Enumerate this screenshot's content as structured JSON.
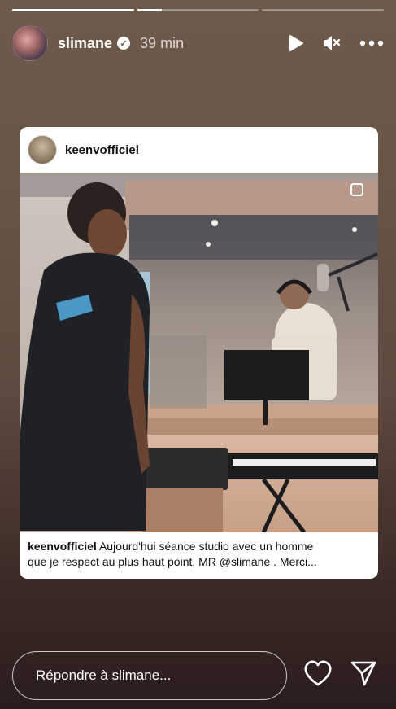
{
  "story": {
    "progress": [
      1.0,
      0.2,
      0.0
    ]
  },
  "header": {
    "username": "slimane",
    "verified": true,
    "time": "39 min",
    "icons": [
      "play-icon",
      "mute-icon",
      "more-icon"
    ]
  },
  "post": {
    "username": "keenvofficiel",
    "caption_user": "keenvofficiel",
    "caption_line1": "Aujourd'hui séance studio avec un homme",
    "caption_line2": "que je respect au plus haut point, MR @slimane . Merci..."
  },
  "footer": {
    "reply_placeholder": "Répondre à slimane...",
    "icons": [
      "heart-icon",
      "send-icon"
    ]
  },
  "colors": {
    "background_top": "#6d5a4a",
    "background_bottom": "#2a1c1c",
    "card": "#ffffff"
  }
}
